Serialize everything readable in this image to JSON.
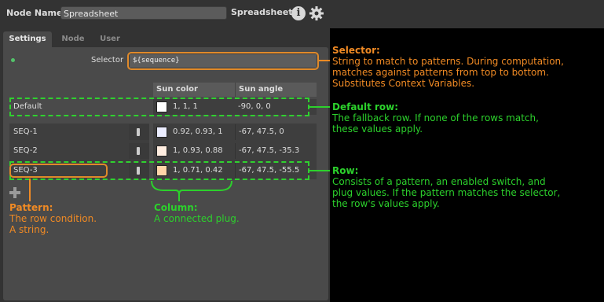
{
  "header": {
    "node_name_label": "Node Name",
    "node_name_value": "Spreadsheet",
    "node_type": "Spreadsheet",
    "info_icon": "info-icon",
    "gear_icon": "gear-icon"
  },
  "tabs": [
    {
      "label": "Settings",
      "active": true
    },
    {
      "label": "Node",
      "active": false
    },
    {
      "label": "User",
      "active": false
    }
  ],
  "selector": {
    "label": "Selector",
    "value": "${sequence}"
  },
  "columns": [
    "Sun color",
    "Sun angle"
  ],
  "default_row": {
    "name": "Default",
    "sun_color": "1, 1, 1",
    "swatch": "#ffffff",
    "sun_angle": "-90, 0, 0"
  },
  "rows": [
    {
      "name": "SEQ-1",
      "sun_color": "0.92, 0.93, 1",
      "swatch": "#ebedff",
      "sun_angle": "-67, 47.5, 0"
    },
    {
      "name": "SEQ-2",
      "sun_color": "1, 0.93, 0.88",
      "swatch": "#ffede0",
      "sun_angle": "-67, 47.5, -35.3"
    },
    {
      "name": "SEQ-3",
      "sun_color": "1, 0.71, 0.42",
      "swatch": "#ffd5a8",
      "sun_angle": "-67, 47.5, -55.5"
    }
  ],
  "annotations": {
    "selector": {
      "title": "Selector:",
      "text": "String to match to patterns. During computation, matches against patterns from top to bottom. Substitutes Context Variables."
    },
    "default_row": {
      "title": "Default row:",
      "text": "The fallback row. If none of the rows match, these values apply."
    },
    "row": {
      "title": "Row:",
      "text": "Consists of a pattern, an enabled switch, and plug values. If the pattern matches the selector, the row's values apply."
    },
    "pattern": {
      "title": "Pattern:",
      "line1": "The row condition.",
      "line2": "A string."
    },
    "column": {
      "title": "Column:",
      "text": "A connected plug."
    }
  },
  "colors": {
    "orange": "#f08a24",
    "green": "#2cd12c"
  }
}
